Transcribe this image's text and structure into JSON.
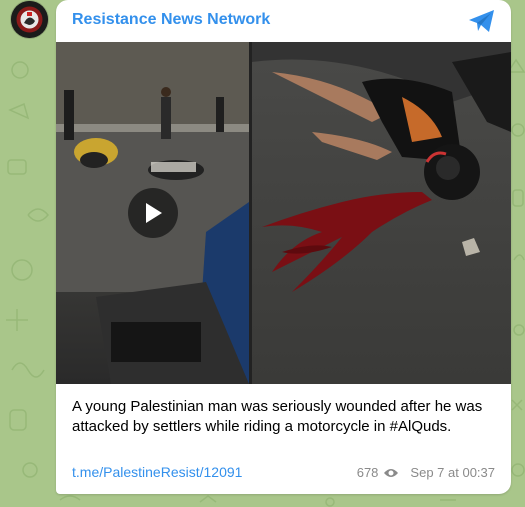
{
  "channel": {
    "name": "Resistance News Network"
  },
  "post": {
    "caption": "A young Palestinian man was seriously wounded after he was attacked by settlers while riding a motorcycle in #AlQuds.",
    "link": "t.me/PalestineResist/12091",
    "views": "678",
    "date": "Sep 7 at 00:37"
  },
  "icons": {
    "share": "telegram-share-icon",
    "views": "eye-icon",
    "play": "play-icon"
  },
  "colors": {
    "accent": "#3390ec",
    "background": "#a9c68a",
    "meta": "#8a8a8a"
  }
}
